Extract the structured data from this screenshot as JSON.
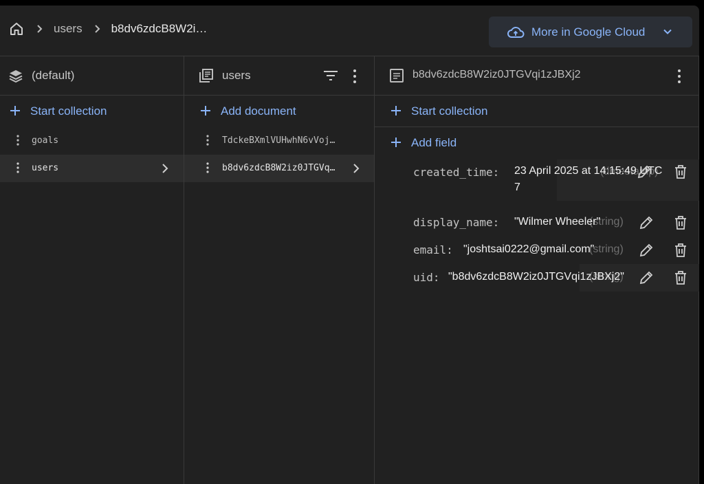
{
  "breadcrumb": {
    "items": [
      "users",
      "b8dv6zdcB8W2i…"
    ]
  },
  "header": {
    "google_cloud_label": "More in Google Cloud"
  },
  "database_column": {
    "title": "(default)",
    "start_collection_label": "Start collection",
    "collections": [
      {
        "name": "goals",
        "selected": false
      },
      {
        "name": "users",
        "selected": true
      }
    ]
  },
  "collection_column": {
    "title": "users",
    "add_document_label": "Add document",
    "documents": [
      {
        "id": "TdckeBXmlVUHwhN6vVoj…",
        "selected": false
      },
      {
        "id": "b8dv6zdcB8W2iz0JTGVq…",
        "selected": true
      }
    ]
  },
  "document_column": {
    "title": "b8dv6zdcB8W2iz0JTGVqi1zJBXj2",
    "start_collection_label": "Start collection",
    "add_field_label": "Add field",
    "fields": [
      {
        "key": "created_time:",
        "value": "23 April 2025 at 14:15:49 UTC",
        "value_line2": "7",
        "type": "(timestamp)"
      },
      {
        "key": "display_name:",
        "value": "\"Wilmer Wheeler\"",
        "type": "(string)"
      },
      {
        "key": "email:",
        "value": "\"joshtsai0222@gmail.com\"",
        "type": "(string)"
      },
      {
        "key": "uid:",
        "value": "\"b8dv6zdcB8W2iz0JTGVqi1zJBXj2\"",
        "type": "(string)"
      }
    ]
  },
  "colors": {
    "accent": "#8ab4f8",
    "background": "#212121",
    "divider": "#3a3a3a"
  }
}
